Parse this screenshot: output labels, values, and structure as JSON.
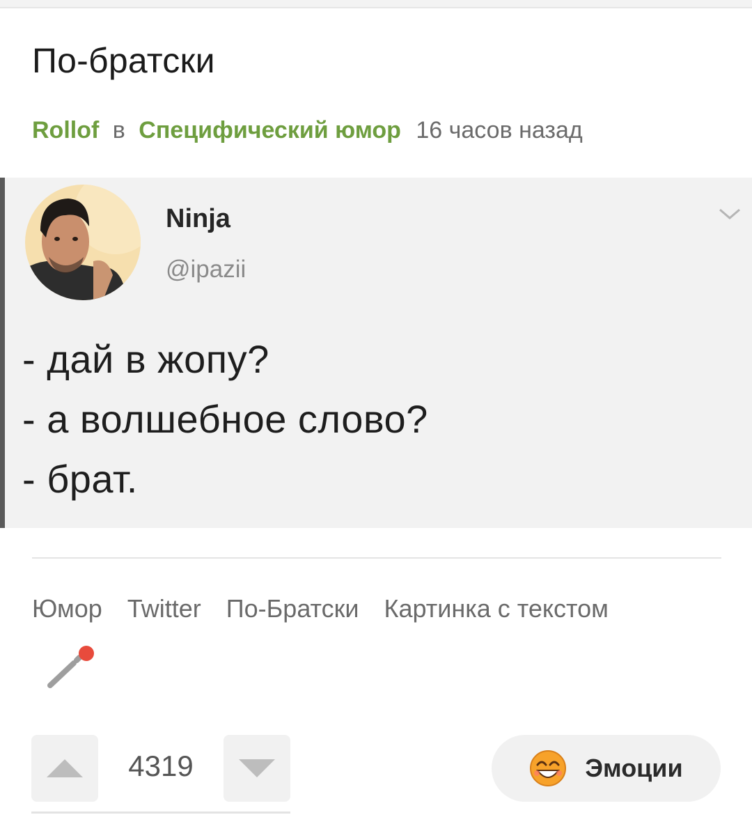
{
  "post": {
    "title": "По-братски",
    "author": "Rollof",
    "preposition": "в",
    "community": "Специфический юмор",
    "time": "16 часов назад"
  },
  "tweet": {
    "name": "Ninja",
    "handle": "@ipazii",
    "lines": [
      "- дай в жопу?",
      "- а волшебное слово?",
      "- брат."
    ]
  },
  "tags": [
    "Юмор",
    "Twitter",
    "По-Братски",
    "Картинка с текстом"
  ],
  "rating": {
    "value": "4319"
  },
  "emotions": {
    "label": "Эмоции"
  },
  "colors": {
    "accent": "#6e9e3f",
    "edit_dot": "#e84b3c",
    "button_bg": "#f1f1f1"
  },
  "icons": {
    "edit": "pencil-icon",
    "vote_up": "triangle-up-icon",
    "vote_down": "triangle-down-icon",
    "emotions": "smiling-face-icon",
    "tweet_menu": "chevron-down-icon"
  }
}
